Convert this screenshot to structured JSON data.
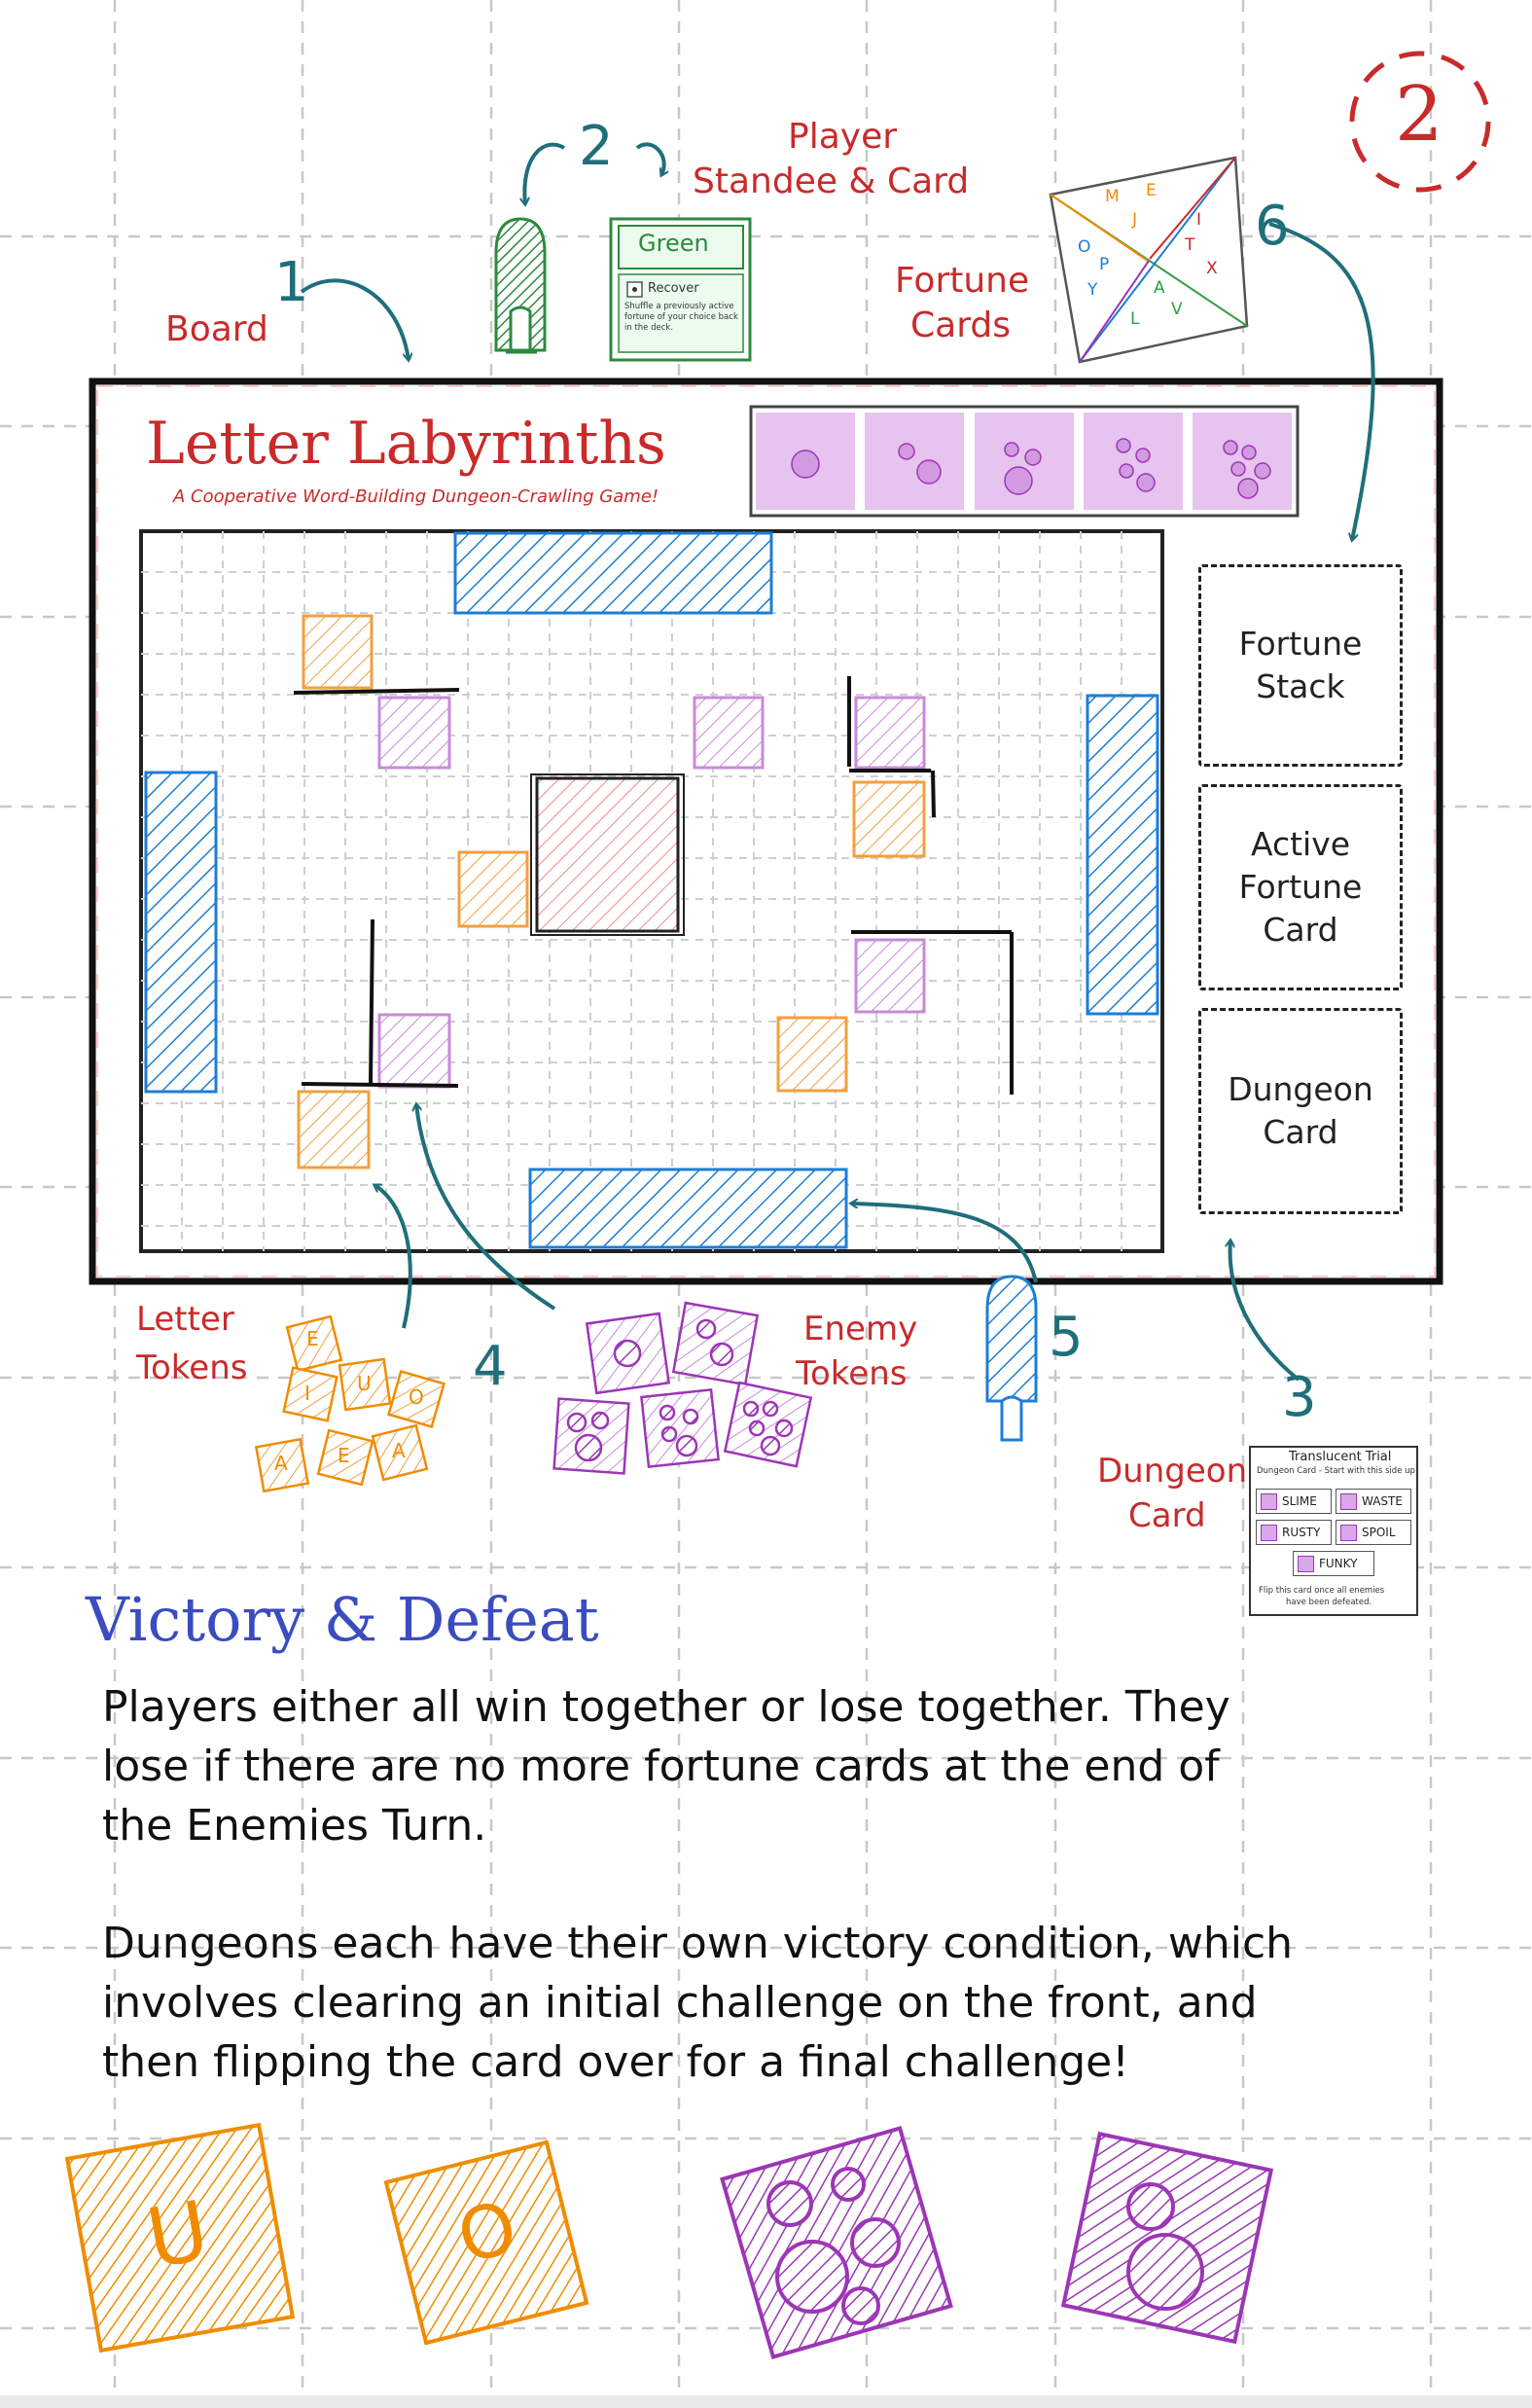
{
  "page_number": "2",
  "title": "Letter Labyrinths",
  "subtitle": "A Cooperative Word-Building Dungeon-Crawling Game!",
  "callouts": {
    "board": {
      "number": "1",
      "label": "Board"
    },
    "player": {
      "number": "2",
      "label_line1": "Player",
      "label_line2": "Standee & Card"
    },
    "dungeon": {
      "number": "3",
      "label_line1": "Dungeon",
      "label_line2": "Card"
    },
    "letters": {
      "number": "4",
      "label_line1": "Letter",
      "label_line2": "Tokens"
    },
    "enemy": {
      "number": "5",
      "label_line1": "Enemy",
      "label_line2": "Tokens"
    },
    "fortune": {
      "number": "6",
      "label_line1": "Fortune",
      "label_line2": "Cards"
    }
  },
  "player_card": {
    "name": "Green",
    "ability": "Recover",
    "text": "Shuffle a previously active fortune of your choice back in the deck."
  },
  "fortune_card_letters": [
    "M",
    "E",
    "J",
    "I",
    "T",
    "X",
    "O",
    "P",
    "Y",
    "A",
    "L",
    "V"
  ],
  "board_slots": {
    "fortune_stack": "Fortune\nStack",
    "active_fortune": "Active\nFortune\nCard",
    "dungeon_card": "Dungeon\nCard"
  },
  "letter_tokens": [
    "E",
    "I",
    "U",
    "O",
    "A",
    "E",
    "A"
  ],
  "dungeon_card": {
    "title": "Translucent Trial",
    "subtitle": "Dungeon Card - Start with this side up!",
    "enemies": [
      "SLIME",
      "WASTE",
      "RUSTY",
      "SPOIL",
      "FUNKY"
    ],
    "footer_line1": "Flip this card once all enemies",
    "footer_line2": "have been defeated."
  },
  "section_heading": "Victory & Defeat",
  "paragraph1_line1": "Players either all win together or lose together. They",
  "paragraph1_line2": "lose if there are no more fortune cards at the end of",
  "paragraph1_line3": "the Enemies Turn.",
  "paragraph2_line1": "Dungeons each have their own victory condition, which",
  "paragraph2_line2": "involves clearing an initial challenge on the front, and",
  "paragraph2_line3": "then flipping the card over for a final challenge!",
  "bottom_token_letters": [
    "U",
    "O"
  ],
  "colors": {
    "red": "#c92a2a",
    "teal": "#1f6f7a",
    "blue": "#1c7ed6",
    "orange": "#f08c00",
    "purple": "#9c36b5",
    "green": "#2b8a3e",
    "heading_blue": "#3b4cc0"
  }
}
